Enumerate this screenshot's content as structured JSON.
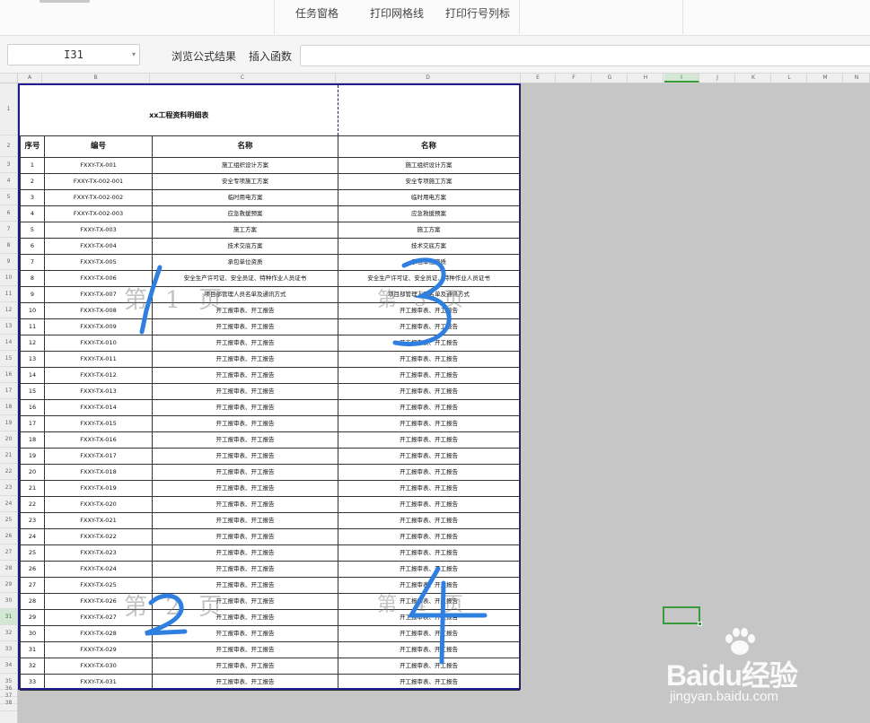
{
  "toolbar": {
    "task_pane": "任务窗格",
    "print_gridlines": "打印网格线",
    "print_row_col_headers": "打印行号列标"
  },
  "formula_bar": {
    "name_box": "I31",
    "browse_result": "浏览公式结果",
    "insert_function": "插入函数"
  },
  "columns": [
    "A",
    "B",
    "C",
    "D",
    "E",
    "F",
    "G",
    "H",
    "I",
    "J",
    "K",
    "L",
    "M",
    "N"
  ],
  "selected_column": "I",
  "rows": [
    "1",
    "2",
    "3",
    "4",
    "5",
    "6",
    "7",
    "8",
    "9",
    "10",
    "11",
    "12",
    "13",
    "14",
    "15",
    "16",
    "17",
    "18",
    "19",
    "20",
    "21",
    "22",
    "23",
    "24",
    "25",
    "26",
    "27",
    "28",
    "29",
    "30",
    "31",
    "32",
    "33",
    "34",
    "35",
    "36",
    "37",
    "38"
  ],
  "selected_row": "31",
  "sheet": {
    "title": "xx工程资料明细表",
    "headers": [
      "序号",
      "编号",
      "名称",
      "名称"
    ],
    "rows": [
      {
        "no": "1",
        "code": "FXXY-TX-001",
        "name": "施工组织设计方案",
        "name2": "施工组织设计方案"
      },
      {
        "no": "2",
        "code": "FXXY-TX-002-001",
        "name": "安全专项施工方案",
        "name2": "安全专项施工方案"
      },
      {
        "no": "3",
        "code": "FXXY-TX-002-002",
        "name": "临时用电方案",
        "name2": "临时用电方案"
      },
      {
        "no": "4",
        "code": "FXXY-TX-002-003",
        "name": "应急救援预案",
        "name2": "应急救援预案"
      },
      {
        "no": "5",
        "code": "FXXY-TX-003",
        "name": "施工方案",
        "name2": "施工方案"
      },
      {
        "no": "6",
        "code": "FXXY-TX-004",
        "name": "技术交底方案",
        "name2": "技术交底方案"
      },
      {
        "no": "7",
        "code": "FXXY-TX-005",
        "name": "承包单位资质",
        "name2": "承包单位资质"
      },
      {
        "no": "8",
        "code": "FXXY-TX-006",
        "name": "安全生产许可证、安全员证、特种作业人员证书",
        "name2": "安全生产许可证、安全员证、特种作业人员证书"
      },
      {
        "no": "9",
        "code": "FXXY-TX-007",
        "name": "项目部管理人员名单及通讯方式",
        "name2": "项目部管理人员名单及通讯方式"
      },
      {
        "no": "10",
        "code": "FXXY-TX-008",
        "name": "开工报审表、开工报告",
        "name2": "开工报审表、开工报告"
      },
      {
        "no": "11",
        "code": "FXXY-TX-009",
        "name": "开工报审表、开工报告",
        "name2": "开工报审表、开工报告"
      },
      {
        "no": "12",
        "code": "FXXY-TX-010",
        "name": "开工报审表、开工报告",
        "name2": "开工报审表、开工报告"
      },
      {
        "no": "13",
        "code": "FXXY-TX-011",
        "name": "开工报审表、开工报告",
        "name2": "开工报审表、开工报告"
      },
      {
        "no": "14",
        "code": "FXXY-TX-012",
        "name": "开工报审表、开工报告",
        "name2": "开工报审表、开工报告"
      },
      {
        "no": "15",
        "code": "FXXY-TX-013",
        "name": "开工报审表、开工报告",
        "name2": "开工报审表、开工报告"
      },
      {
        "no": "16",
        "code": "FXXY-TX-014",
        "name": "开工报审表、开工报告",
        "name2": "开工报审表、开工报告"
      },
      {
        "no": "17",
        "code": "FXXY-TX-015",
        "name": "开工报审表、开工报告",
        "name2": "开工报审表、开工报告"
      },
      {
        "no": "18",
        "code": "FXXY-TX-016",
        "name": "开工报审表、开工报告",
        "name2": "开工报审表、开工报告"
      },
      {
        "no": "19",
        "code": "FXXY-TX-017",
        "name": "开工报审表、开工报告",
        "name2": "开工报审表、开工报告"
      },
      {
        "no": "20",
        "code": "FXXY-TX-018",
        "name": "开工报审表、开工报告",
        "name2": "开工报审表、开工报告"
      },
      {
        "no": "21",
        "code": "FXXY-TX-019",
        "name": "开工报审表、开工报告",
        "name2": "开工报审表、开工报告"
      },
      {
        "no": "22",
        "code": "FXXY-TX-020",
        "name": "开工报审表、开工报告",
        "name2": "开工报审表、开工报告"
      },
      {
        "no": "23",
        "code": "FXXY-TX-021",
        "name": "开工报审表、开工报告",
        "name2": "开工报审表、开工报告"
      },
      {
        "no": "24",
        "code": "FXXY-TX-022",
        "name": "开工报审表、开工报告",
        "name2": "开工报审表、开工报告"
      },
      {
        "no": "25",
        "code": "FXXY-TX-023",
        "name": "开工报审表、开工报告",
        "name2": "开工报审表、开工报告"
      },
      {
        "no": "26",
        "code": "FXXY-TX-024",
        "name": "开工报审表、开工报告",
        "name2": "开工报审表、开工报告"
      },
      {
        "no": "27",
        "code": "FXXY-TX-025",
        "name": "开工报审表、开工报告",
        "name2": "开工报审表、开工报告"
      },
      {
        "no": "28",
        "code": "FXXY-TX-026",
        "name": "开工报审表、开工报告",
        "name2": "开工报审表、开工报告"
      },
      {
        "no": "29",
        "code": "FXXY-TX-027",
        "name": "开工报审表、开工报告",
        "name2": "开工报审表、开工报告"
      },
      {
        "no": "30",
        "code": "FXXY-TX-028",
        "name": "开工报审表、开工报告",
        "name2": "开工报审表、开工报告"
      },
      {
        "no": "31",
        "code": "FXXY-TX-029",
        "name": "开工报审表、开工报告",
        "name2": "开工报审表、开工报告"
      },
      {
        "no": "32",
        "code": "FXXY-TX-030",
        "name": "开工报审表、开工报告",
        "name2": "开工报审表、开工报告"
      },
      {
        "no": "33",
        "code": "FXXY-TX-031",
        "name": "开工报审表、开工报告",
        "name2": "开工报审表、开工报告"
      }
    ]
  },
  "page_watermarks": [
    "第 1 页",
    "第 3 页",
    "第 2 页",
    "第 4 页"
  ],
  "watermark": {
    "brand": "Baidu经验",
    "url": "jingyan.baidu.com"
  },
  "colors": {
    "page_border": "#1c1c8c",
    "selection": "#3a9b3a",
    "handwriting": "#2f7fe0",
    "background": "#c6c6c6"
  }
}
